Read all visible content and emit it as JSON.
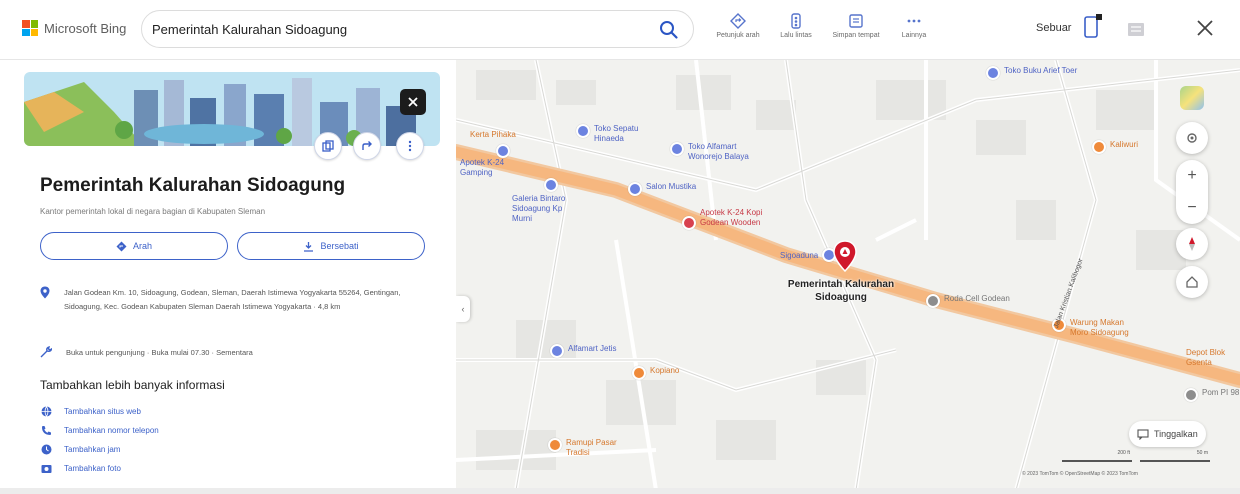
{
  "topbar": {
    "brand": "Microsoft Bing",
    "search_value": "Pemerintah Kalurahan Sidoagung",
    "tools": [
      {
        "label": "Petunjuk arah",
        "icon": "directions-icon"
      },
      {
        "label": "Lalu lintas",
        "icon": "traffic-icon"
      },
      {
        "label": "Simpan tempat",
        "icon": "save-place-icon"
      },
      {
        "label": "Lainnya",
        "icon": "more-icon"
      }
    ],
    "signin_label": "Sebuar"
  },
  "panel": {
    "title": "Pemerintah Kalurahan Sidoagung",
    "subtitle": "Kantor pemerintah lokal di negara bagian di Kabupaten Sleman",
    "actions": {
      "directions": "Arah",
      "save": "Bersebati"
    },
    "address": "Jalan Godean Km. 10, Sidoagung, Godean, Sleman, Daerah Istimewa Yogyakarta 55264, Gentingan, Sidoagung, Kec. Godean Kabupaten Sleman Daerah Istimewa Yogyakarta · 4,8 km",
    "hours": "Buka untuk pengunjung · Buka mulai 07.30 · Sementara",
    "more_title": "Tambahkan lebih banyak informasi",
    "more_items": [
      {
        "label": "Tambahkan situs web",
        "icon": "globe-icon"
      },
      {
        "label": "Tambahkan nomor telepon",
        "icon": "phone-icon"
      },
      {
        "label": "Tambahkan jam",
        "icon": "clock-icon"
      },
      {
        "label": "Tambahkan foto",
        "icon": "photo-icon"
      }
    ]
  },
  "map": {
    "pin_label": "Pemerintah Kalurahan Sidoagung",
    "street_label": "Jalan Kristian Kalibogor",
    "feedback_label": "Tinggalkan",
    "scale_labels": [
      "200 ft",
      "50 m"
    ],
    "attribution": "© 2023 TomTom  © OpenStreetMap  © 2023 TomTom",
    "pois": [
      {
        "label": "Toko Buku Arief Toer",
        "color": "blue"
      },
      {
        "label": "Toko Sepatu Hinaeda",
        "color": "blue"
      },
      {
        "label": "Toko Alfamart Wonorejo Balaya",
        "color": "blue"
      },
      {
        "label": "Kerta Pihaka",
        "color": "orange"
      },
      {
        "label": "Apotek K-24 Gamping",
        "color": "blue"
      },
      {
        "label": "Salon Mustika",
        "color": "blue"
      },
      {
        "label": "Galeria Bintaro Sidoagung Kp Murni",
        "color": "blue"
      },
      {
        "label": "Apotek K-24 Kopi Godean Wooden",
        "color": "red"
      },
      {
        "label": "Sigoaduna",
        "color": "blue"
      },
      {
        "label": "Kaliwuri",
        "color": "orange"
      },
      {
        "label": "Roda Cell Godean",
        "color": "gray"
      },
      {
        "label": "Warung Makan Moro Sidoagung",
        "color": "orange"
      },
      {
        "label": "Alfamart Jetis",
        "color": "blue"
      },
      {
        "label": "Kopiano",
        "color": "orange"
      },
      {
        "label": "Ramupi Pasar Tradisi",
        "color": "orange"
      },
      {
        "label": "Depot Blok Gsenta",
        "color": "orange"
      },
      {
        "label": "Pom PI 98",
        "color": "gray"
      }
    ]
  }
}
